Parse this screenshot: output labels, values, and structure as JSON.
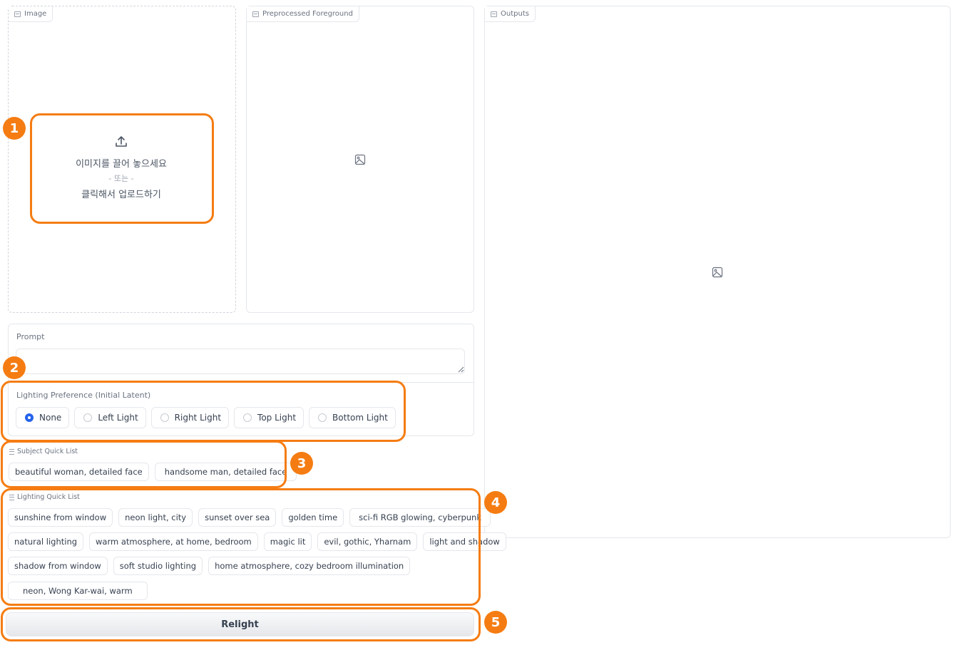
{
  "image_panel": {
    "label": "Image",
    "upload": {
      "line1": "이미지를 끌어 놓으세요",
      "or": "- 또는 -",
      "line2": "클릭해서 업로드하기"
    }
  },
  "foreground_panel": {
    "label": "Preprocessed Foreground"
  },
  "outputs_panel": {
    "label": "Outputs"
  },
  "prompt": {
    "label": "Prompt",
    "value": "",
    "placeholder": ""
  },
  "lighting_preference": {
    "label": "Lighting Preference (Initial Latent)",
    "selected": "None",
    "options": [
      "None",
      "Left Light",
      "Right Light",
      "Top Light",
      "Bottom Light"
    ]
  },
  "subject_quick_list": {
    "label": "Subject Quick List",
    "items": [
      "beautiful woman, detailed face",
      "handsome man, detailed face"
    ]
  },
  "lighting_quick_list": {
    "label": "Lighting Quick List",
    "rows": [
      [
        "sunshine from window",
        "neon light, city",
        "sunset over sea",
        "golden time",
        "sci-fi RGB glowing, cyberpunk"
      ],
      [
        "natural lighting",
        "warm atmosphere, at home, bedroom",
        "magic lit",
        "evil, gothic, Yharnam",
        "light and shadow"
      ],
      [
        "shadow from window",
        "soft studio lighting",
        "home atmosphere, cozy bedroom illumination"
      ],
      [
        "neon, Wong Kar-wai, warm"
      ]
    ]
  },
  "relight_button": {
    "label": "Relight"
  },
  "annotations": {
    "badges": [
      "1",
      "2",
      "3",
      "4",
      "5"
    ],
    "color": "#f57c12"
  },
  "colors": {
    "accent": "#2563eb",
    "border": "#e5e7eb",
    "highlight": "#f57c12"
  }
}
